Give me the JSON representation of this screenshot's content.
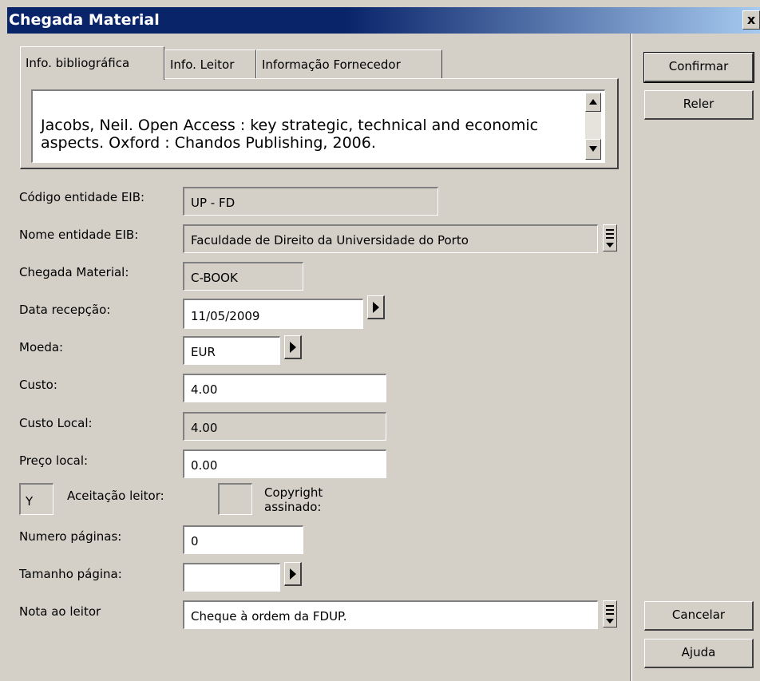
{
  "window": {
    "title": "Chegada Material",
    "close_label": "x"
  },
  "tabs": [
    {
      "label": "Info. bibliográfica",
      "active": true
    },
    {
      "label": "Info. Leitor",
      "active": false
    },
    {
      "label": "Informação Fornecedor",
      "active": false
    }
  ],
  "bibliographic": {
    "text": "Jacobs, Neil. Open Access : key strategic, technical and economic aspects. Oxford : Chandos Publishing, 2006."
  },
  "form": {
    "codigo_entidade_label": "Código entidade EIB:",
    "codigo_entidade_value": "UP - FD",
    "nome_entidade_label": "Nome entidade EIB:",
    "nome_entidade_value": "Faculdade de Direito da Universidade do Porto",
    "chegada_material_label": "Chegada Material:",
    "chegada_material_value": "C-BOOK",
    "data_recepcao_label": "Data recepção:",
    "data_recepcao_value": "11/05/2009",
    "moeda_label": "Moeda:",
    "moeda_value": "EUR",
    "custo_label": "Custo:",
    "custo_value": "4.00",
    "custo_local_label": "Custo Local:",
    "custo_local_value": "4.00",
    "preco_local_label": "Preço local:",
    "preco_local_value": "0.00",
    "aceitacao_value": "Y",
    "aceitacao_label": "Aceitação leitor:",
    "copyright_value": "",
    "copyright_label": "Copyright assinado:",
    "numero_paginas_label": "Numero páginas:",
    "numero_paginas_value": "0",
    "tamanho_pagina_label": "Tamanho página:",
    "tamanho_pagina_value": "",
    "nota_leitor_label": "Nota ao leitor",
    "nota_leitor_value": "Cheque à ordem da FDUP."
  },
  "buttons": {
    "confirmar": "Confirmar",
    "reler": "Reler",
    "cancelar": "Cancelar",
    "ajuda": "Ajuda"
  },
  "colors": {
    "title_bar": "#0a246a",
    "face": "#d4d0c8",
    "field": "#ffffff"
  }
}
